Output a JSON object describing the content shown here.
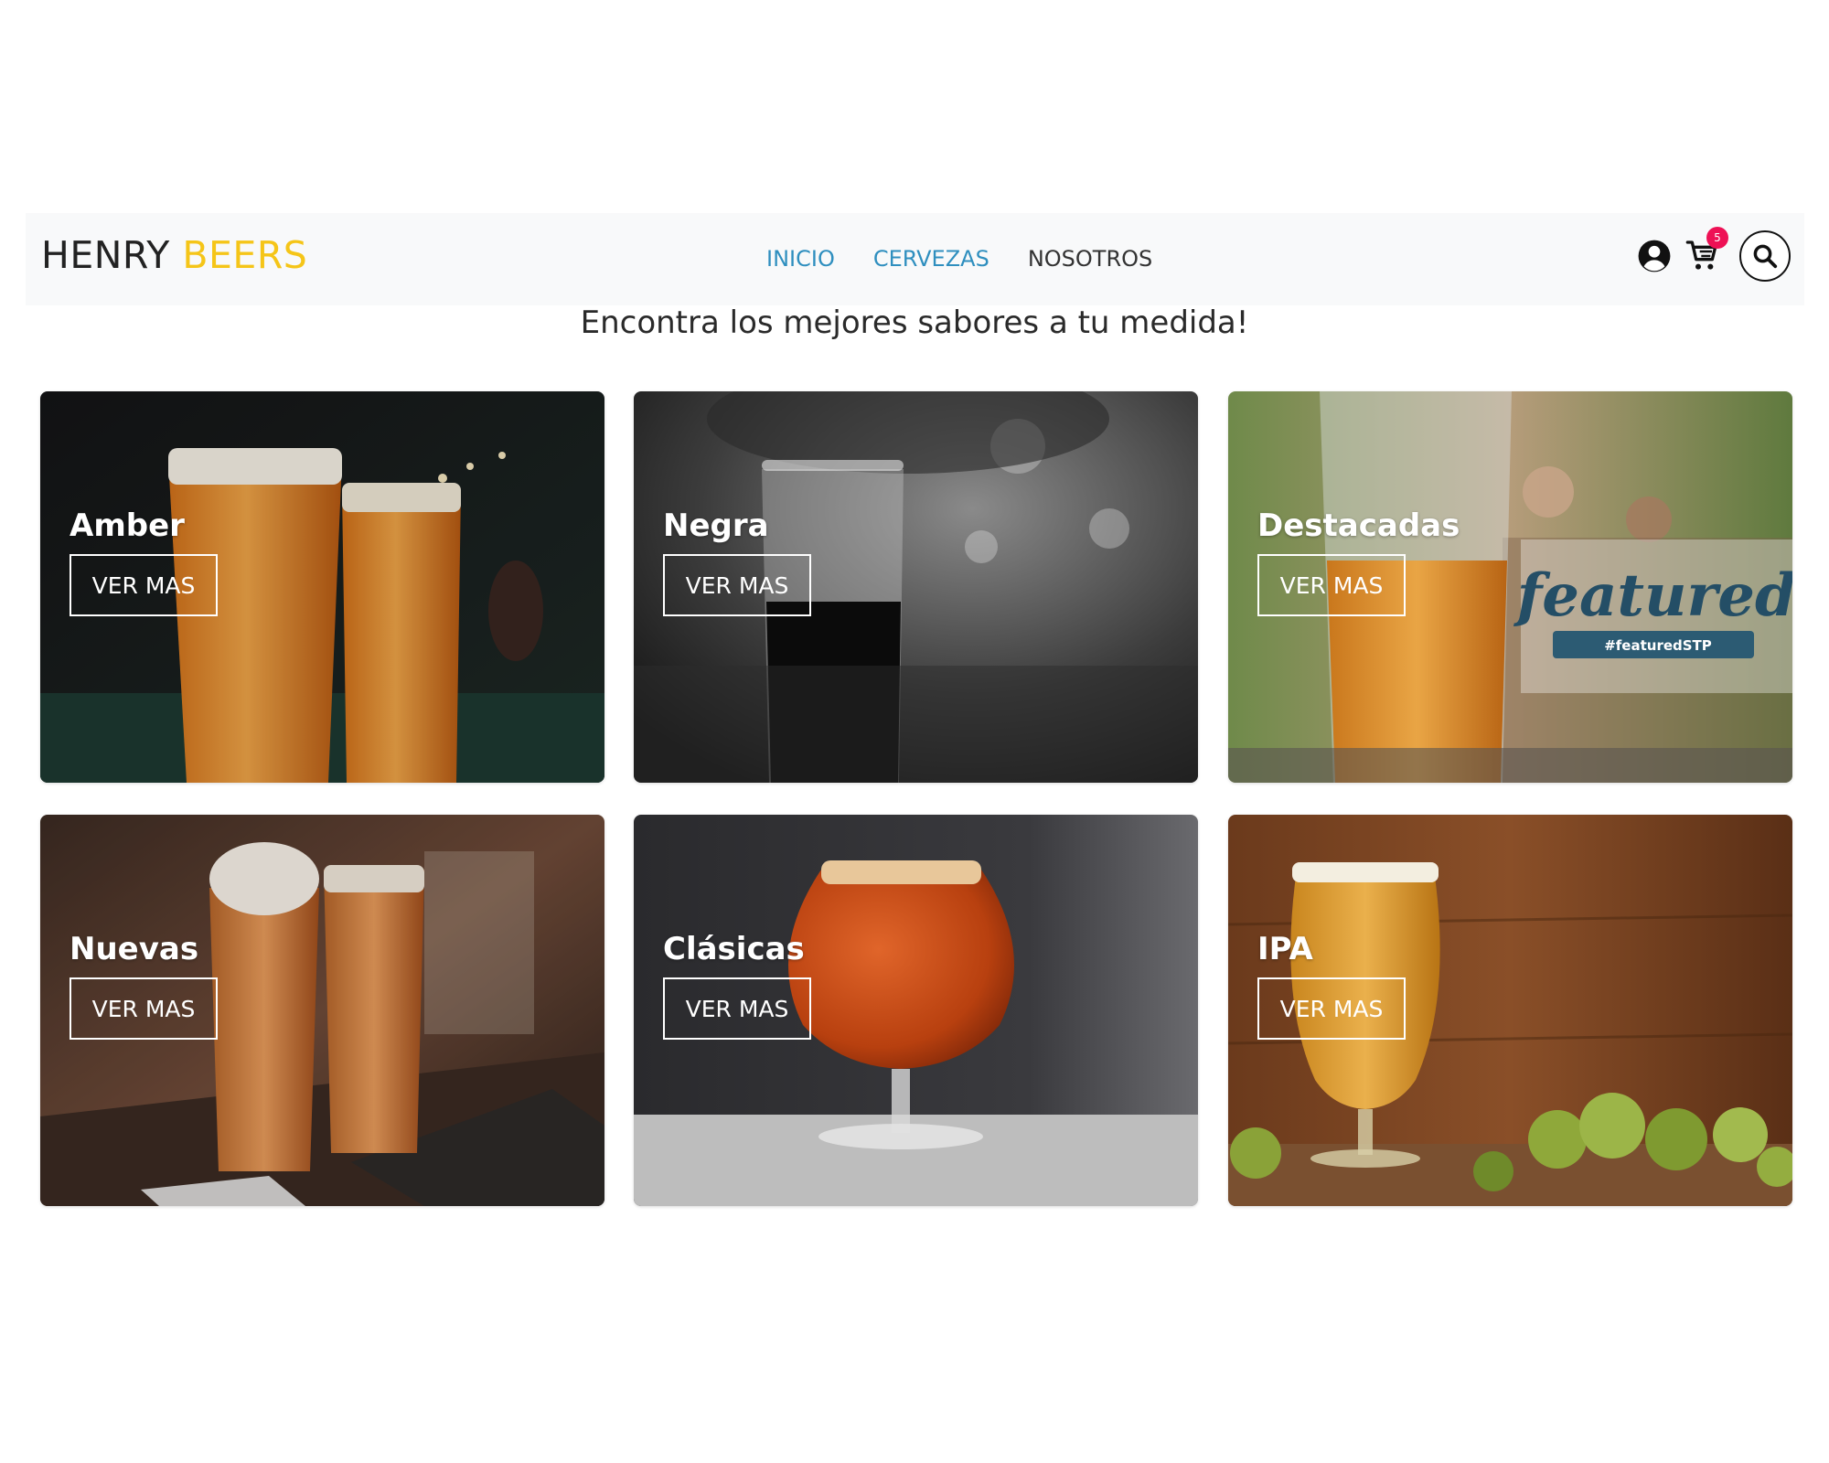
{
  "brand": {
    "part1": "HENRY",
    "part2": "BEERS",
    "color_part2": "#f5c518"
  },
  "nav": {
    "links": [
      {
        "label": "INICIO",
        "color": "#2f8fbf"
      },
      {
        "label": "CERVEZAS",
        "color": "#2f8fbf"
      },
      {
        "label": "NOSOTROS",
        "color": "#333333"
      }
    ],
    "icons": {
      "user": "user-circle-icon",
      "cart": "shopping-cart-icon",
      "search": "search-icon"
    },
    "cart_count": "5",
    "badge_color": "#ee1155"
  },
  "headline": "Encontra los mejores sabores a tu medida!",
  "categories": [
    {
      "title": "Amber",
      "button": "VER MAS"
    },
    {
      "title": "Negra",
      "button": "VER MAS"
    },
    {
      "title": "Destacadas",
      "button": "VER MAS",
      "image_text": "featured:",
      "image_subtext": "#featuredSTP"
    },
    {
      "title": "Nuevas",
      "button": "VER MAS"
    },
    {
      "title": "Clásicas",
      "button": "VER MAS"
    },
    {
      "title": "IPA",
      "button": "VER MAS"
    }
  ]
}
